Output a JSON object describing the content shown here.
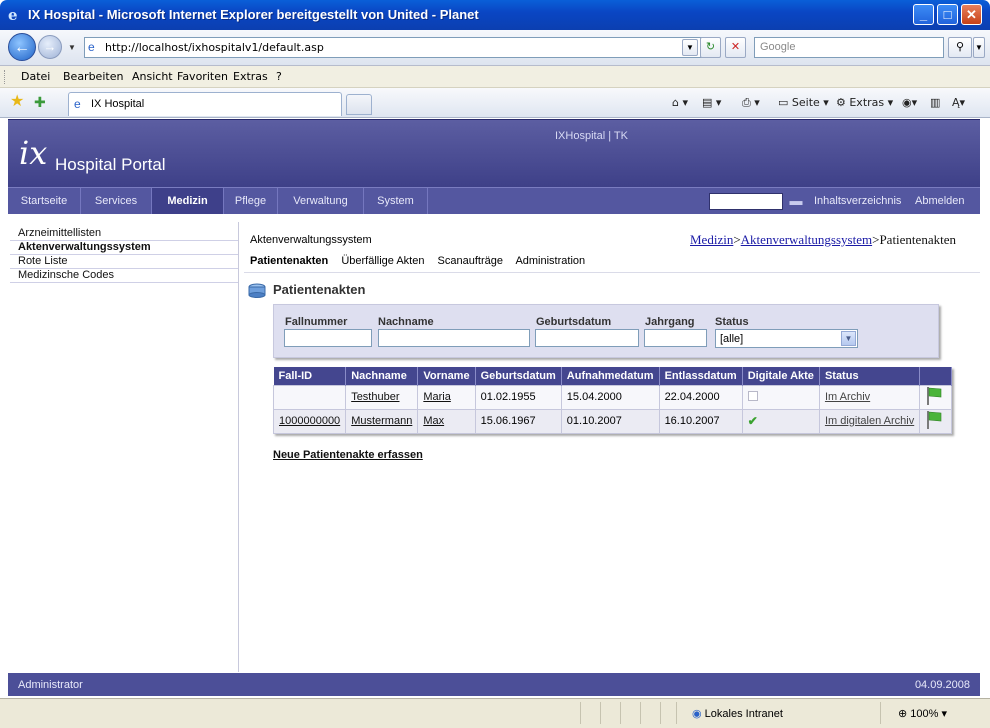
{
  "window": {
    "title": "IX Hospital - Microsoft Internet Explorer bereitgestellt von United - Planet",
    "url": "http://localhost/ixhospitalv1/default.asp",
    "search_placeholder": "Google",
    "menu": [
      "Datei",
      "Bearbeiten",
      "Ansicht",
      "Favoriten",
      "Extras",
      "?"
    ],
    "tab_label": "IX Hospital",
    "commands": {
      "page": "Seite",
      "tools": "Extras"
    }
  },
  "portal": {
    "logo_mark": "ix",
    "logo_text": "Hospital Portal",
    "user_links": "IXHospital  |  TK",
    "nav": [
      "Startseite",
      "Services",
      "Medizin",
      "Pflege",
      "Verwaltung",
      "System"
    ],
    "nav_active": "Medizin",
    "toc_link": "Inhaltsverzeichnis",
    "logout_link": "Abmelden"
  },
  "sidebar": {
    "items": [
      {
        "label": "Arzneimittellisten"
      },
      {
        "label": "Aktenverwaltungssystem"
      },
      {
        "label": "Rote Liste"
      },
      {
        "label": "Medizinsche Codes"
      }
    ]
  },
  "main": {
    "title": "Aktenverwaltungssystem",
    "breadcrumb": {
      "crumb1": "Medizin",
      "sep": ">",
      "crumb2": "Aktenverwaltungssystem",
      "current": "Patientenakten"
    },
    "subnav": [
      "Patientenakten",
      "Überfällige Akten",
      "Scanaufträge",
      "Administration"
    ],
    "section_title": "Patientenakten",
    "filter": {
      "labels": [
        "Fallnummer",
        "Nachname",
        "Geburtsdatum",
        "Jahrgang",
        "Status"
      ],
      "status_value": "[alle]"
    },
    "table": {
      "headers": [
        "Fall-ID",
        "Nachname",
        "Vorname",
        "Geburtsdatum",
        "Aufnahmedatum",
        "Entlassdatum",
        "Digitale Akte",
        "Status",
        ""
      ],
      "rows": [
        {
          "fall_id": "",
          "nachname": "Testhuber",
          "vorname": "Maria",
          "geburtsdatum": "01.02.1955",
          "aufnahme": "15.04.2000",
          "entlass": "22.04.2000",
          "digital": false,
          "status": "Im Archiv"
        },
        {
          "fall_id": "1000000000",
          "nachname": "Mustermann",
          "vorname": "Max",
          "geburtsdatum": "15.06.1967",
          "aufnahme": "01.10.2007",
          "entlass": "16.10.2007",
          "digital": true,
          "status": "Im digitalen Archiv"
        }
      ]
    },
    "new_record_link": "Neue Patientenakte erfassen"
  },
  "footer": {
    "user": "Administrator",
    "date": "04.09.2008"
  },
  "statusbar": {
    "zone": "Lokales Intranet",
    "zoom": "100%"
  },
  "colors": {
    "header_bg": "#3e4088",
    "nav_bg": "#5457a0",
    "table_header": "#44468f"
  }
}
